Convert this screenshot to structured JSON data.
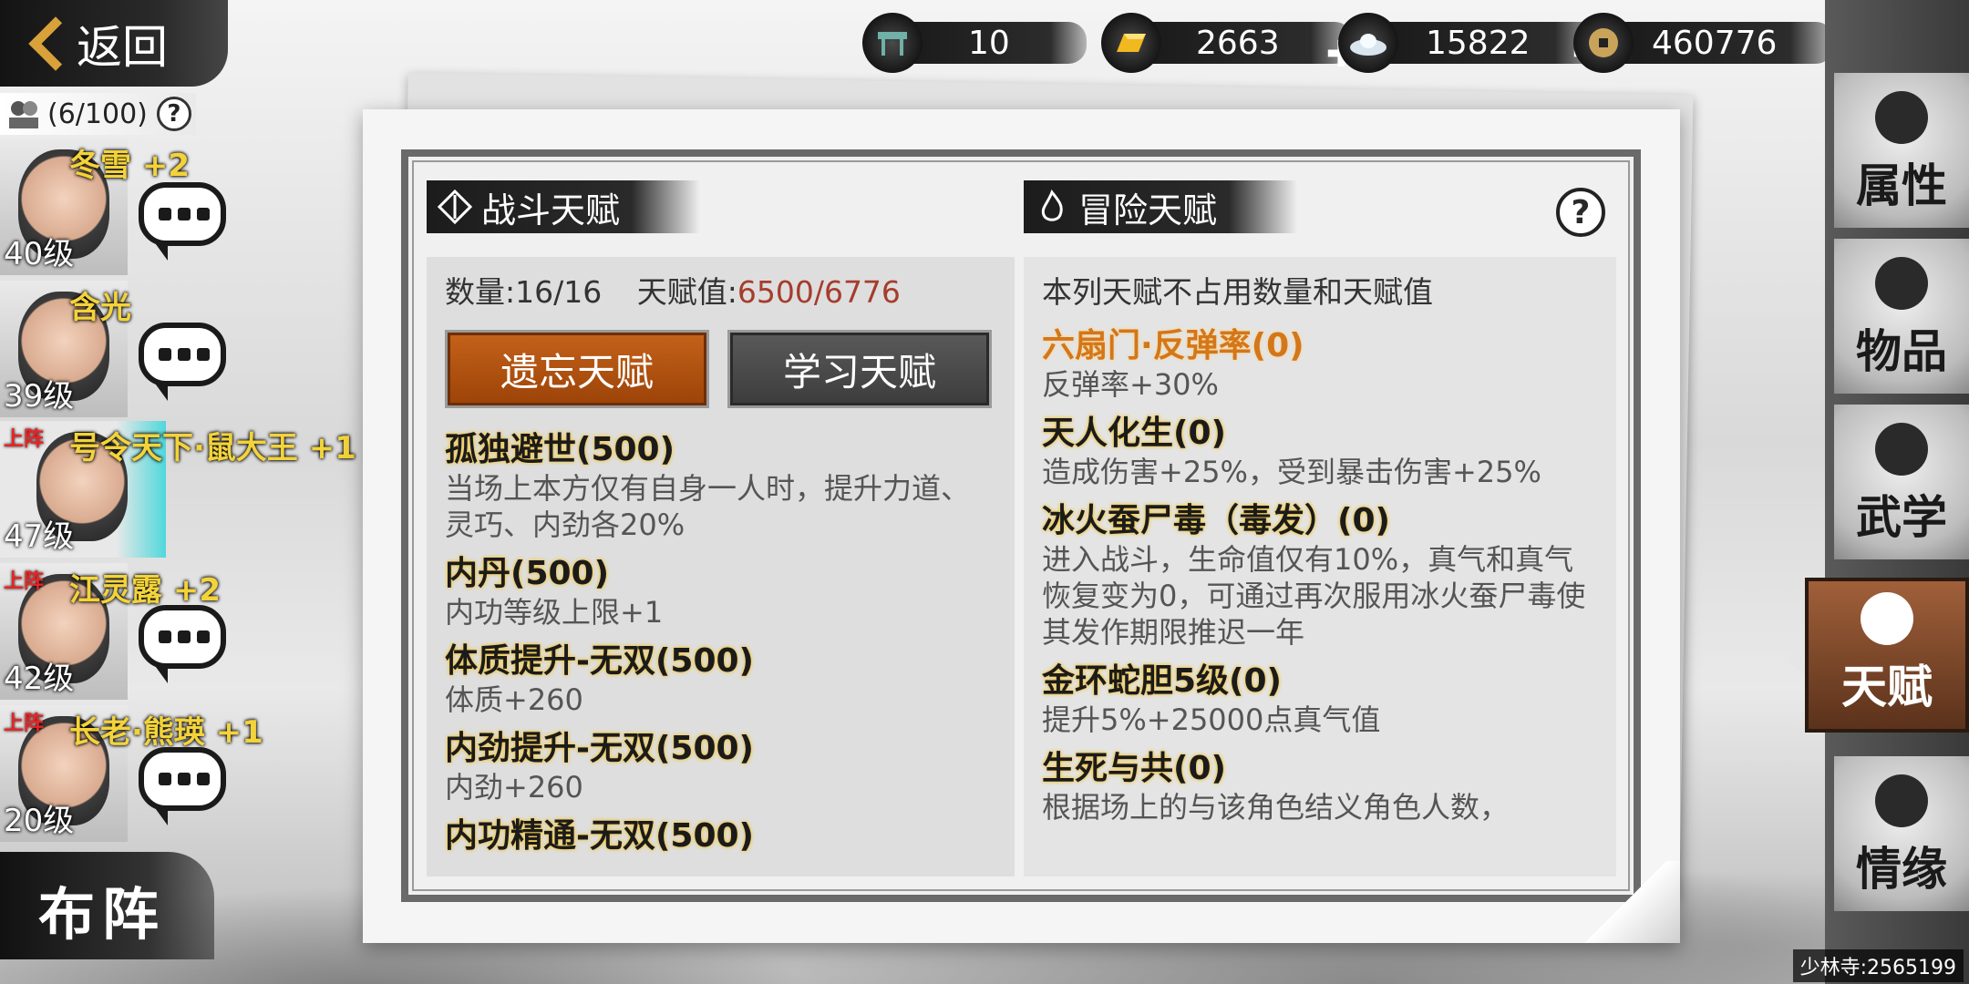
{
  "topbar": {
    "back_label": "返回",
    "resources": [
      {
        "icon": "ticket-stand-icon",
        "value": "10",
        "has_plus": false
      },
      {
        "icon": "gold-bar-icon",
        "value": "2663",
        "has_plus": true
      },
      {
        "icon": "silver-ingot-icon",
        "value": "15822",
        "has_plus": true
      },
      {
        "icon": "copper-coin-icon",
        "value": "460776",
        "has_plus": false
      }
    ]
  },
  "roster": {
    "capacity": "(6/100)",
    "members": [
      {
        "name": "冬雪",
        "bonus": "+2",
        "level": "40级",
        "on_stage": ""
      },
      {
        "name": "含光",
        "bonus": "",
        "level": "39级",
        "on_stage": ""
      },
      {
        "name": "号令天下·鼠大王",
        "bonus": "+1",
        "level": "47级",
        "on_stage": "上阵"
      },
      {
        "name": "江灵露",
        "bonus": "+2",
        "level": "42级",
        "on_stage": "上阵"
      },
      {
        "name": "长老·熊瑛",
        "bonus": "+1",
        "level": "20级",
        "on_stage": "上阵"
      }
    ],
    "formation_label": "布阵"
  },
  "combat": {
    "title": "战斗天赋",
    "count_label": "数量:16/16",
    "value_label": "天赋值:",
    "value": "6500/6776",
    "forget_button": "遗忘天赋",
    "learn_button": "学习天赋",
    "talents": [
      {
        "name": "孤独避世(500)",
        "desc": "当场上本方仅有自身一人时，提升力道、灵巧、内劲各20%"
      },
      {
        "name": "内丹(500)",
        "desc": "内功等级上限+1"
      },
      {
        "name": "体质提升-无双(500)",
        "desc": "体质+260"
      },
      {
        "name": "内劲提升-无双(500)",
        "desc": "内劲+260"
      },
      {
        "name": "内功精通-无双(500)",
        "desc": ""
      }
    ]
  },
  "adventure": {
    "title": "冒险天赋",
    "note": "本列天赋不占用数量和天赋值",
    "talents": [
      {
        "name": "六扇门·反弹率(0)",
        "desc": "反弹率+30%"
      },
      {
        "name": "天人化生(0)",
        "desc": "造成伤害+25%，受到暴击伤害+25%"
      },
      {
        "name": "冰火蚕尸毒（毒发）(0)",
        "desc": "进入战斗，生命值仅有10%，真气和真气恢复变为0，可通过再次服用冰火蚕尸毒使其发作期限推迟一年"
      },
      {
        "name": "金环蛇胆5级(0)",
        "desc": "提升5%+25000点真气值"
      },
      {
        "name": "生死与共(0)",
        "desc": "根据场上的与该角色结义角色人数，"
      }
    ]
  },
  "sidenav": {
    "items": [
      {
        "label": "属性",
        "icon": "mask-icon"
      },
      {
        "label": "物品",
        "icon": "gift-box-icon"
      },
      {
        "label": "武学",
        "icon": "book-icon"
      },
      {
        "label": "天赋",
        "icon": "talent-tree-icon"
      },
      {
        "label": "情缘",
        "icon": "heart-icon"
      }
    ],
    "active": "天赋"
  },
  "footer": {
    "server_id": "少林寺:2565199"
  },
  "colors": {
    "forget_button": "#b35410",
    "talent_value": "#a63c2c",
    "talent_glow": "#f1c84a"
  }
}
